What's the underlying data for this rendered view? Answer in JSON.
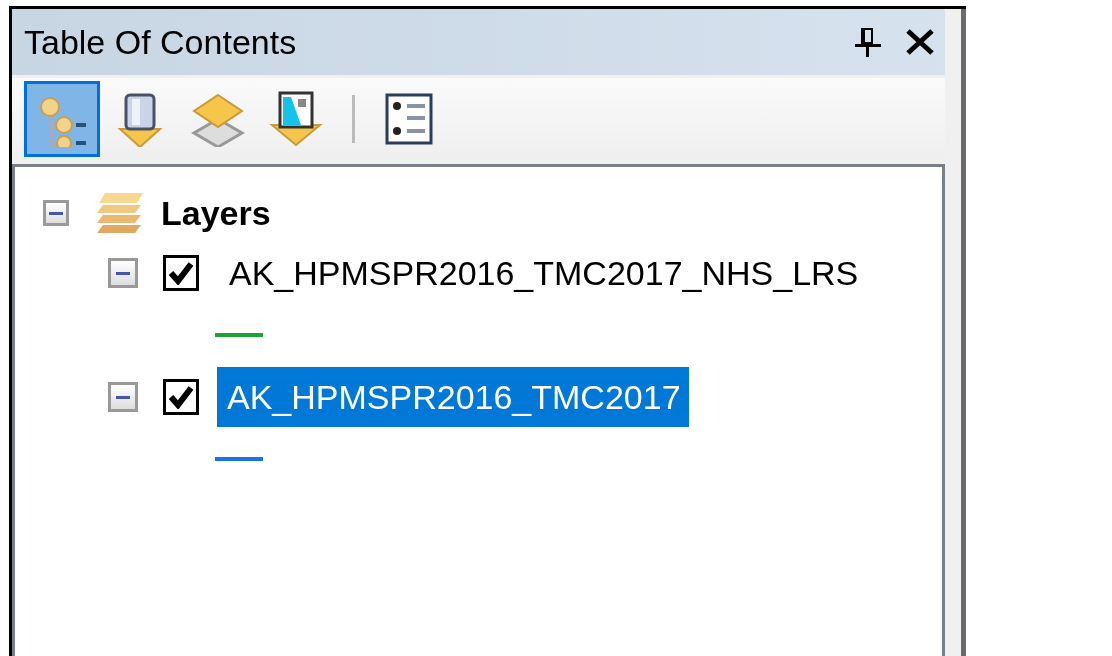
{
  "panel": {
    "title": "Table Of Contents"
  },
  "toolbar": [
    {
      "kind": "drawing-order",
      "selected": true
    },
    {
      "kind": "source",
      "selected": false
    },
    {
      "kind": "visibility",
      "selected": false
    },
    {
      "kind": "selection",
      "selected": false
    },
    {
      "kind": "separator"
    },
    {
      "kind": "options",
      "selected": false
    }
  ],
  "tree": {
    "label": "Layers",
    "expanded": true,
    "children": [
      {
        "label": "AK_HPMSPR2016_TMC2017_NHS_LRS",
        "checked": true,
        "expanded": true,
        "selected": false,
        "color": "#1aa532"
      },
      {
        "label": "AK_HPMSPR2016_TMC2017",
        "checked": true,
        "expanded": true,
        "selected": true,
        "color": "#1a72f0"
      }
    ]
  }
}
